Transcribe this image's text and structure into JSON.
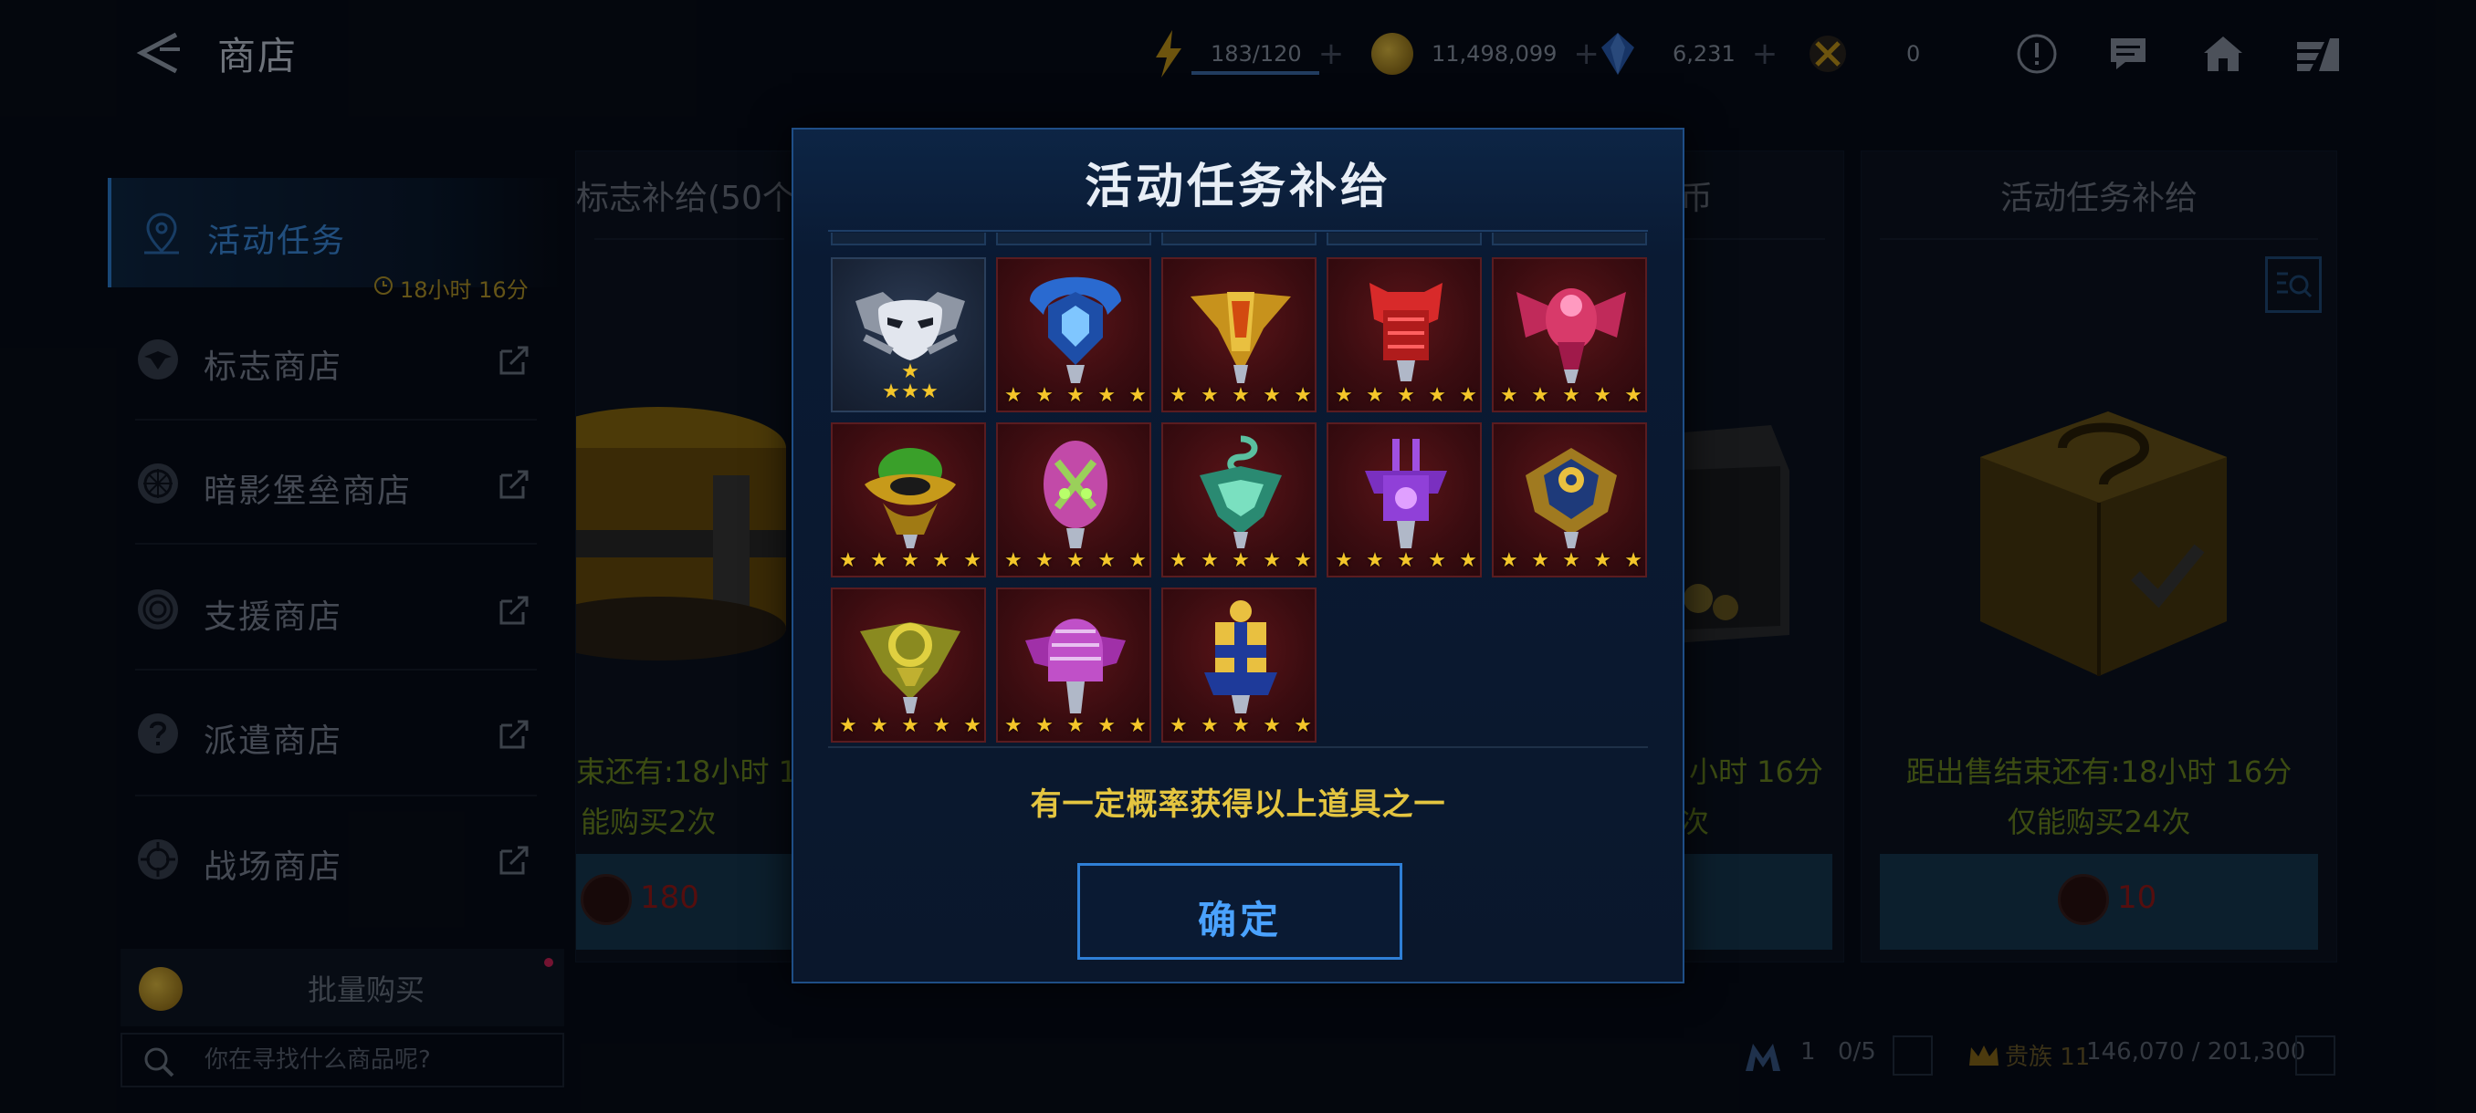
{
  "header": {
    "title": "商店",
    "energy": "183/120",
    "gold": "11,498,099",
    "crystal": "6,231",
    "token": "0"
  },
  "sidebar": {
    "items": [
      {
        "label": "活动任务",
        "timer": "18小时 16分",
        "active": true
      },
      {
        "label": "标志商店"
      },
      {
        "label": "暗影堡垒商店"
      },
      {
        "label": "支援商店"
      },
      {
        "label": "派遣商店"
      },
      {
        "label": "战场商店"
      }
    ],
    "bulk_label": "批量购买",
    "search_placeholder": "你在寻找什么商品呢?"
  },
  "cards": [
    {
      "title": "标志补给(50个",
      "sale": "束还有:18小时 16",
      "limit": "能购买2次",
      "price": "180"
    },
    {
      "title": "币",
      "sale": "小时 16分",
      "limit": "次",
      "price": ""
    },
    {
      "title": "活动任务补给",
      "sale": "距出售结束还有:18小时 16分",
      "limit": "仅能购买24次",
      "price": "10"
    }
  ],
  "footer": {
    "level": "1",
    "progress": "0/5",
    "rank": "贵族 11",
    "points": "146,070 / 201,300"
  },
  "modal": {
    "title": "活动任务补给",
    "note": "有一定概率获得以上道具之一",
    "confirm_label": "确定",
    "items": [
      {
        "icon": "silver-mask-emblem-icon",
        "rarity": "blue"
      },
      {
        "icon": "blue-crest-emblem-icon",
        "rarity": "red"
      },
      {
        "icon": "gold-arrow-emblem-icon",
        "rarity": "red"
      },
      {
        "icon": "red-helmet-emblem-icon",
        "rarity": "red"
      },
      {
        "icon": "pink-spider-emblem-icon",
        "rarity": "red"
      },
      {
        "icon": "green-eye-emblem-icon",
        "rarity": "red"
      },
      {
        "icon": "green-pod-emblem-icon",
        "rarity": "red"
      },
      {
        "icon": "teal-snake-emblem-icon",
        "rarity": "red"
      },
      {
        "icon": "purple-tower-emblem-icon",
        "rarity": "red"
      },
      {
        "icon": "gold-gear-emblem-icon",
        "rarity": "red"
      },
      {
        "icon": "olive-ring-emblem-icon",
        "rarity": "red"
      },
      {
        "icon": "purple-dome-emblem-icon",
        "rarity": "red"
      },
      {
        "icon": "gold-cross-emblem-icon",
        "rarity": "red"
      }
    ]
  },
  "colors": {
    "accent": "#2f7fd6",
    "note_yellow": "#e4c540",
    "sale_green": "#6d8a22",
    "price_red": "#9b1b1b",
    "star_gold": "#f4c62a"
  }
}
